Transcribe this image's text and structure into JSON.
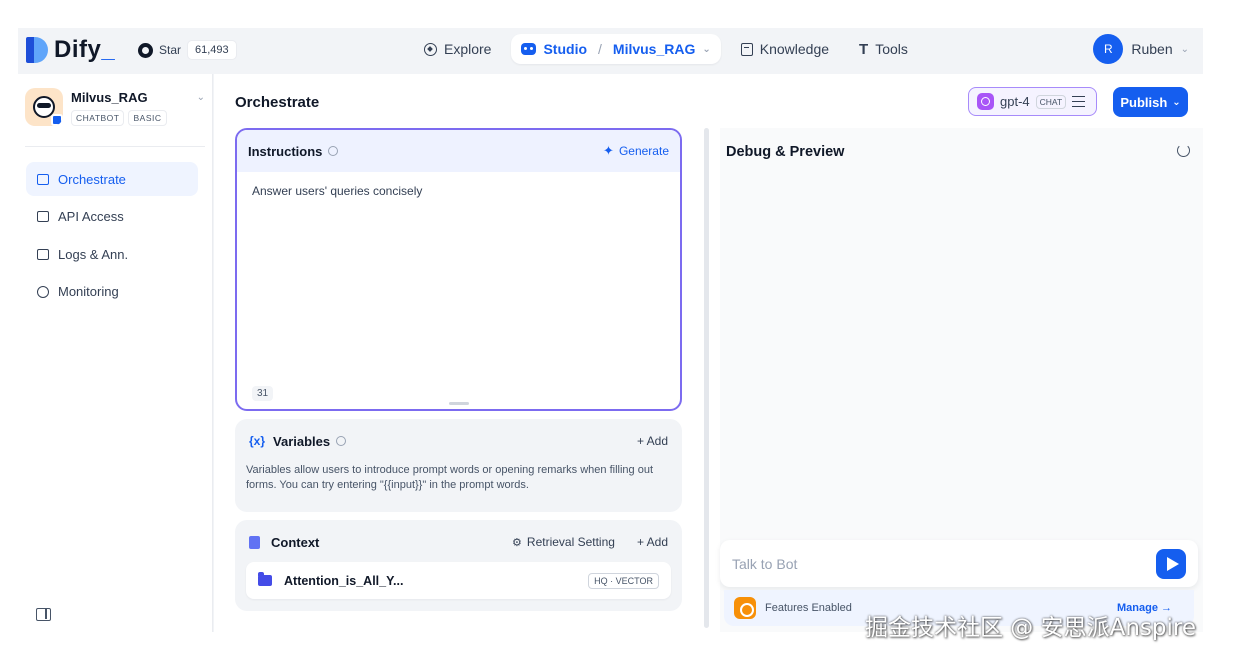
{
  "topbar": {
    "brand": "Dify",
    "github": {
      "star_label": "Star",
      "star_count": "61,493"
    },
    "nav": {
      "explore": "Explore",
      "studio": "Studio",
      "separator": "/",
      "current_app": "Milvus_RAG",
      "knowledge": "Knowledge",
      "tools": "Tools"
    },
    "user": {
      "initial": "R",
      "name": "Ruben"
    }
  },
  "sidebar": {
    "app_name": "Milvus_RAG",
    "tags": [
      "CHATBOT",
      "BASIC"
    ],
    "items": [
      {
        "label": "Orchestrate",
        "active": true
      },
      {
        "label": "API Access",
        "active": false
      },
      {
        "label": "Logs & Ann.",
        "active": false
      },
      {
        "label": "Monitoring",
        "active": false
      }
    ]
  },
  "header": {
    "title": "Orchestrate",
    "model": {
      "name": "gpt-4",
      "mode": "CHAT"
    },
    "publish_label": "Publish"
  },
  "instructions": {
    "title": "Instructions",
    "generate_label": "Generate",
    "prompt": "Answer users' queries concisely",
    "char_count": "31"
  },
  "variables": {
    "icon": "{x}",
    "title": "Variables",
    "add_label": "Add",
    "description": "Variables allow users to introduce prompt words or opening remarks when filling out forms. You can try entering \"{{input}}\" in the prompt words."
  },
  "context": {
    "title": "Context",
    "retrieval_label": "Retrieval Setting",
    "add_label": "Add",
    "dataset": {
      "name": "Attention_is_All_Y...",
      "badge": "HQ · VECTOR"
    }
  },
  "debug": {
    "title": "Debug & Preview",
    "input_placeholder": "Talk to Bot",
    "features_label": "Features Enabled",
    "manage_label": "Manage →"
  },
  "watermark": "掘金技术社区 @ 安思派Anspire",
  "colors": {
    "accent": "#155eef",
    "prompt_border": "#7c6bf0",
    "model_border": "#a78bfa"
  }
}
